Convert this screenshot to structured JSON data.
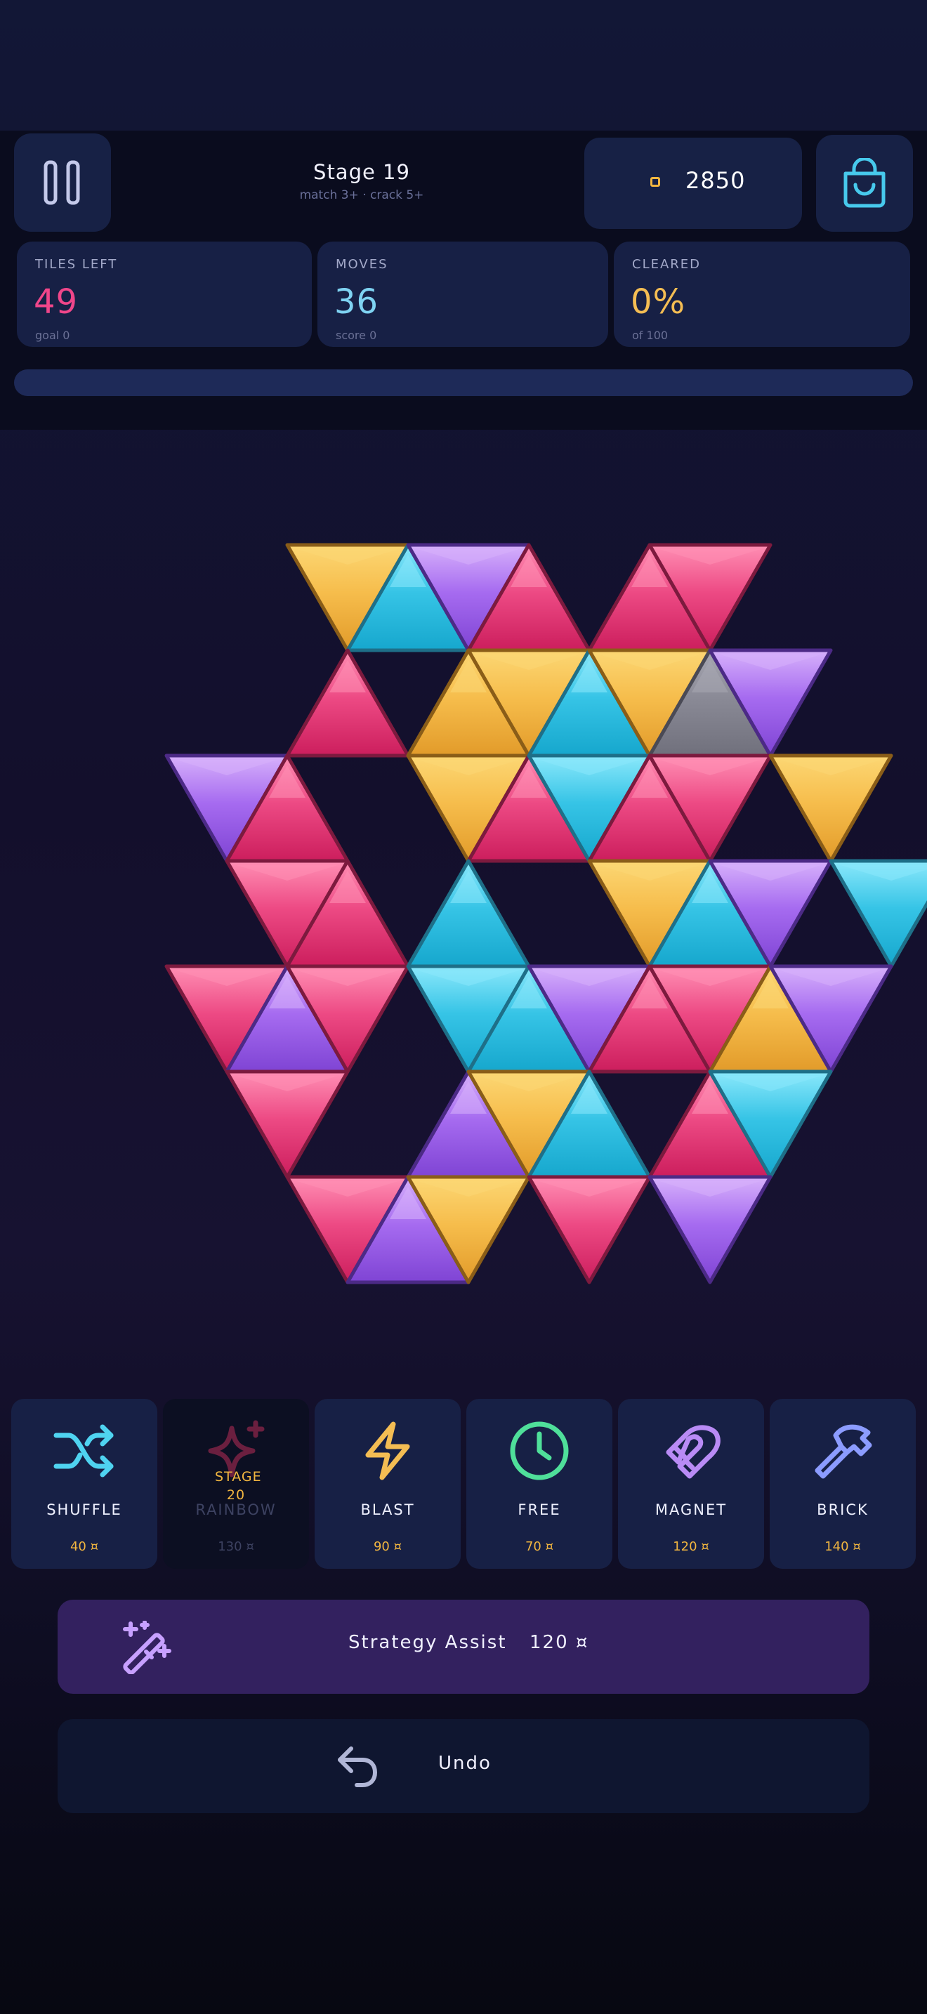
{
  "header": {
    "stage_title": "Stage 19",
    "stage_rule": "match 3+ · crack 5+",
    "coins": "2850",
    "coin_icon": "coin-icon",
    "pause_icon": "pause-icon",
    "shop_icon": "shopping-bag-icon"
  },
  "stats": [
    {
      "label": "TILES LEFT",
      "value": "49",
      "sub": "goal 0",
      "color": "#f0468a"
    },
    {
      "label": "MOVES",
      "value": "36",
      "sub": "score 0",
      "color": "#7fd3f2"
    },
    {
      "label": "CLEARED",
      "value": "0%",
      "sub": "of 100",
      "color": "#f4bd53"
    }
  ],
  "progress": {
    "cleared_fraction": 0
  },
  "board": {
    "colors": {
      "Y": {
        "light": "#fcd774",
        "mid": "#f6bd4c",
        "dark": "#e29b2a",
        "edge": "#8a5d18"
      },
      "C": {
        "light": "#8be8fb",
        "mid": "#36c4e6",
        "dark": "#16a7cd",
        "edge": "#1e6f88"
      },
      "P": {
        "light": "#d7b1fb",
        "mid": "#a66bf0",
        "dark": "#7f44d4",
        "edge": "#4c2a86"
      },
      "M": {
        "light": "#ff8fb4",
        "mid": "#ed4a84",
        "dark": "#cc1e5d",
        "edge": "#7c1a3e"
      },
      "G": {
        "light": "#a7a7b2",
        "mid": "#8a8a96",
        "dark": "#70707c",
        "edge": "#4a4a55"
      }
    },
    "rows": [
      [
        [
          4,
          "Y"
        ],
        [
          5,
          "C"
        ],
        [
          6,
          "P"
        ],
        [
          7,
          "M"
        ],
        [
          9,
          "M"
        ],
        [
          10,
          "M"
        ]
      ],
      [
        [
          4,
          "M"
        ],
        [
          6,
          "Y"
        ],
        [
          7,
          "Y"
        ],
        [
          8,
          "C"
        ],
        [
          9,
          "Y"
        ],
        [
          10,
          "G"
        ],
        [
          11,
          "P"
        ]
      ],
      [
        [
          2,
          "P"
        ],
        [
          3,
          "M"
        ],
        [
          6,
          "Y"
        ],
        [
          7,
          "M"
        ],
        [
          8,
          "C"
        ],
        [
          9,
          "M"
        ],
        [
          10,
          "M"
        ],
        [
          12,
          "Y"
        ]
      ],
      [
        [
          3,
          "M"
        ],
        [
          4,
          "M"
        ],
        [
          6,
          "C"
        ],
        [
          9,
          "Y"
        ],
        [
          10,
          "C"
        ],
        [
          11,
          "P"
        ],
        [
          13,
          "C"
        ]
      ],
      [
        [
          2,
          "M"
        ],
        [
          3,
          "P"
        ],
        [
          4,
          "M"
        ],
        [
          6,
          "C"
        ],
        [
          7,
          "C"
        ],
        [
          8,
          "P"
        ],
        [
          9,
          "M"
        ],
        [
          10,
          "M"
        ],
        [
          11,
          "Y"
        ],
        [
          12,
          "P"
        ]
      ],
      [
        [
          3,
          "M"
        ],
        [
          6,
          "P"
        ],
        [
          7,
          "Y"
        ],
        [
          8,
          "C"
        ],
        [
          10,
          "M"
        ],
        [
          11,
          "C"
        ]
      ],
      [
        [
          4,
          "M"
        ],
        [
          5,
          "P"
        ],
        [
          6,
          "Y"
        ],
        [
          8,
          "M"
        ],
        [
          10,
          "P"
        ]
      ]
    ]
  },
  "powerups": [
    {
      "name": "SHUFFLE",
      "price": "40 ¤",
      "icon": "shuffle-icon",
      "color": "#4fd3f0",
      "locked": false
    },
    {
      "name": "RAINBOW",
      "price": "130 ¤",
      "icon": "sparkle-icon",
      "color": "#6b1f3f",
      "locked": true,
      "lock_text": "STAGE 20"
    },
    {
      "name": "BLAST",
      "price": "90 ¤",
      "icon": "lightning-icon",
      "color": "#f4bd53",
      "locked": false
    },
    {
      "name": "FREE",
      "price": "70 ¤",
      "icon": "clock-icon",
      "color": "#4fdf9a",
      "locked": false
    },
    {
      "name": "MAGNET",
      "price": "120 ¤",
      "icon": "magnet-icon",
      "color": "#b98bf5",
      "locked": false
    },
    {
      "name": "BRICK",
      "price": "140 ¤",
      "icon": "hammer-icon",
      "color": "#8c9cff",
      "locked": false
    }
  ],
  "assist": {
    "label": "Strategy Assist",
    "price": "120 ¤",
    "icon": "magic-wand-icon",
    "color": "#c7a0ff"
  },
  "undo": {
    "label": "Undo",
    "icon": "undo-icon",
    "color": "#b0b6d6"
  }
}
